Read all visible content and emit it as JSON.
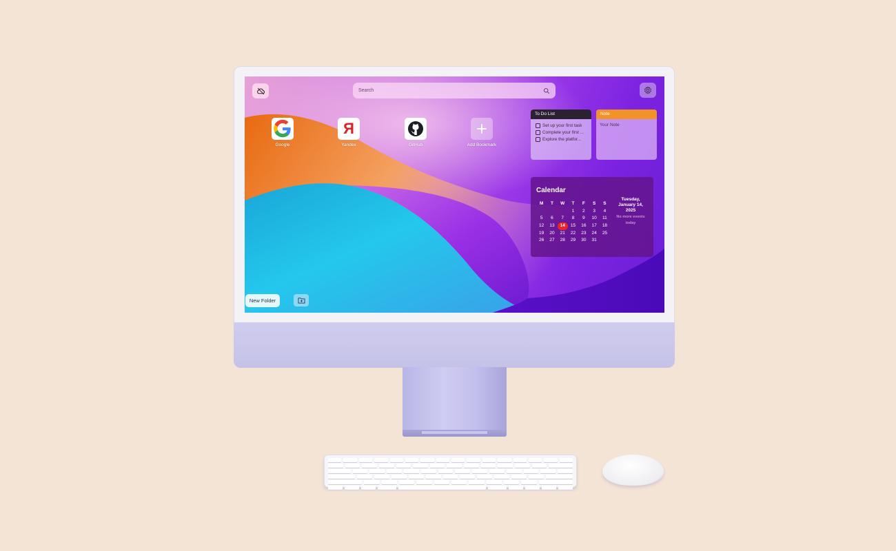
{
  "search": {
    "placeholder": "Search"
  },
  "bookmarks": [
    {
      "label": "Google",
      "icon": "google-logo"
    },
    {
      "label": "Yandex",
      "icon": "yandex-logo",
      "glyph": "Я"
    },
    {
      "label": "GitHub",
      "icon": "github-logo"
    },
    {
      "label": "Add Bookmark",
      "icon": "plus-icon"
    }
  ],
  "todo": {
    "title": "To Do List",
    "items": [
      "Set up your first task",
      "Complete your first ...",
      "Explore the platfor..."
    ]
  },
  "note": {
    "title": "Note",
    "body": "Your Note"
  },
  "calendar": {
    "title": "Calendar",
    "weekdays": [
      "M",
      "T",
      "W",
      "T",
      "F",
      "S",
      "S"
    ],
    "leading_blanks": 3,
    "days_in_month": 31,
    "today": 14,
    "date_line1": "Tuesday,",
    "date_line2": "January 14,",
    "date_line3": "2025",
    "no_events_line1": "No more events",
    "no_events_line2": "today"
  },
  "bottom": {
    "new_folder_label": "New Folder"
  },
  "colors": {
    "today": "#e8262a",
    "note_header": "#f39228",
    "todo_header": "#2a2230"
  }
}
